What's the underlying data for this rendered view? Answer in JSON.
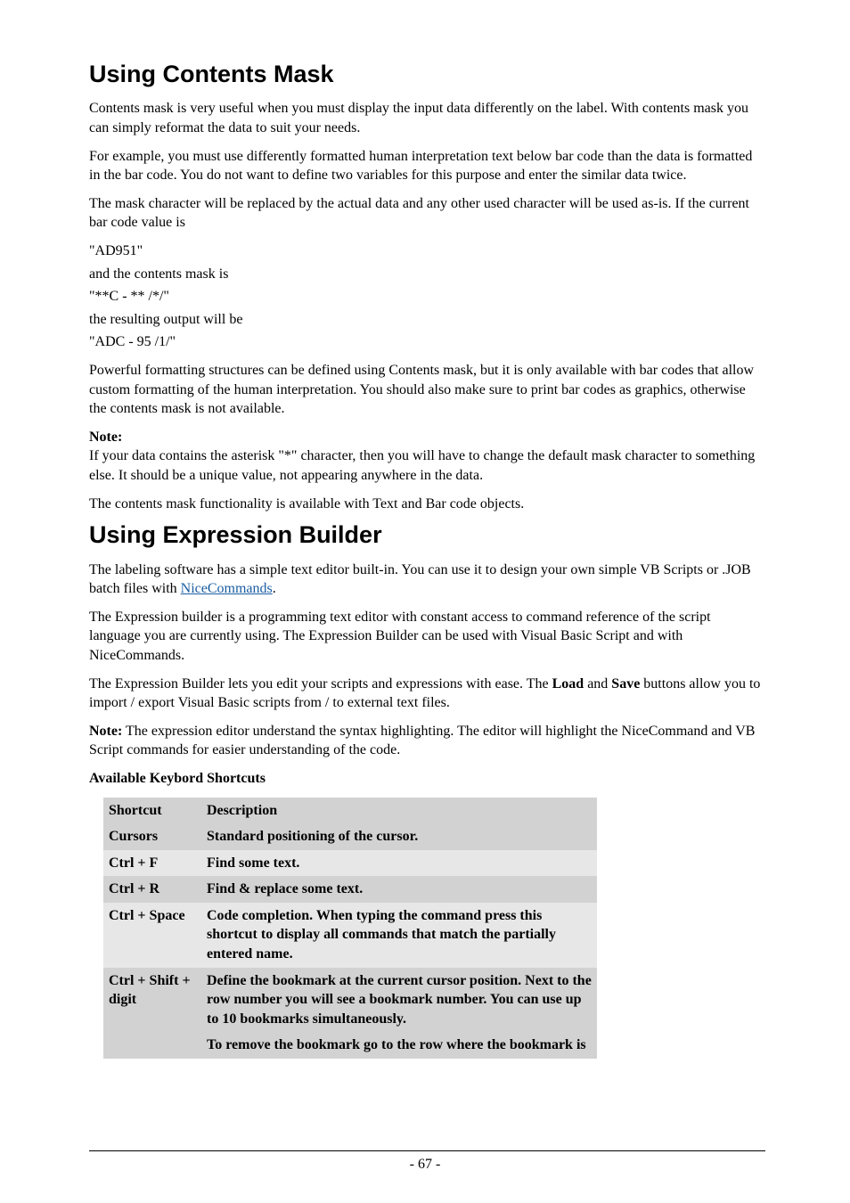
{
  "section1": {
    "title": "Using Contents Mask",
    "p1": "Contents mask is very useful when you must display the input data differently on the label. With contents mask you can simply reformat the data to suit your needs.",
    "p2": "For example, you must use differently formatted human interpretation text below bar code than the data is formatted in the bar code. You do not want to define two variables for this purpose and enter the similar data twice.",
    "p3": "The mask character will be replaced by the actual data and any other used character will be used as-is. If the current bar code value is",
    "code1": "\"AD951\"",
    "p4": "and the contents mask is",
    "code2": "\"**C - ** /*/\"",
    "p5": "the resulting output will be",
    "code3": "\"ADC - 95 /1/\"",
    "p6": "Powerful formatting structures can be defined using Contents mask, but it is only available with bar codes that allow custom formatting of the human interpretation. You should also make sure to print bar codes as graphics, otherwise the contents mask is not available.",
    "noteLabel": "Note:",
    "noteBody": " If your data contains the asterisk \"*\" character, then you will have to change the default mask character to something else. It should be a unique value, not appearing anywhere in the data.",
    "p7": "The contents mask functionality is available with Text and Bar code objects."
  },
  "section2": {
    "title": "Using Expression Builder",
    "p1a": "The labeling software has a simple text editor built-in. You can use it to design your own simple VB Scripts or .JOB batch files with ",
    "linkText": "NiceCommands",
    "p1b": ".",
    "p2": "The Expression builder is a programming text editor with constant access to command reference of the script language you are currently using. The Expression Builder can be used with Visual Basic Script and with NiceCommands.",
    "p3a": "The Expression Builder lets you edit your scripts and expressions with ease. The ",
    "loadWord": "Load",
    "p3mid": " and ",
    "saveWord": "Save",
    "p3b": " buttons allow you to import / export Visual Basic scripts from / to external text files.",
    "p4noteLabel": "Note:",
    "p4body": " The expression editor understand the syntax highlighting. The editor will highlight the NiceCommand and VB Script commands for easier understanding of the code.",
    "tableCaption": "Available Keybord Shortcuts",
    "headers": {
      "c1": "Shortcut",
      "c2": "Description"
    },
    "rows": [
      {
        "c1": "Cursors",
        "c2": "Standard positioning of the cursor."
      },
      {
        "c1": "Ctrl + F",
        "c2": "Find some text."
      },
      {
        "c1": "Ctrl + R",
        "c2": "Find & replace some text."
      },
      {
        "c1": "Ctrl + Space",
        "c2": "Code completion. When typing the command press this shortcut to display all commands that match the partially entered name."
      },
      {
        "c1": "Ctrl + Shift + digit",
        "c2a": "Define the bookmark at the current cursor position. Next to the row number you will see a bookmark number. You can use up to 10 bookmarks simultaneously.",
        "c2b": "To remove the bookmark go to the row where the bookmark is"
      }
    ]
  },
  "pageNumber": "- 67 -"
}
